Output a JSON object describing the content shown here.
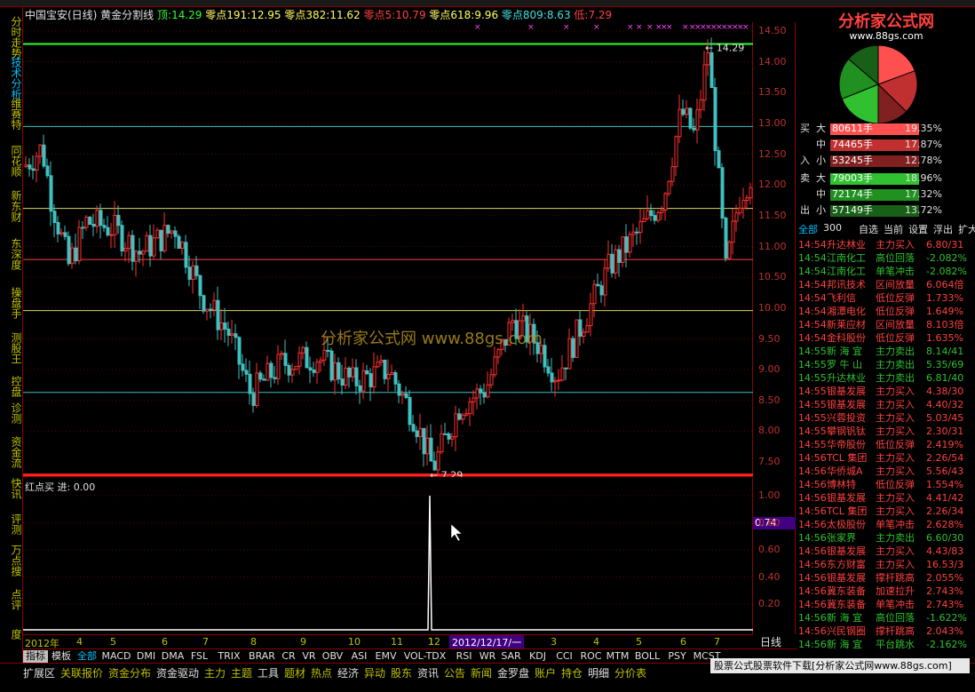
{
  "window": {
    "title": "中国宝安(日线) 黄金分割线"
  },
  "indicator": {
    "top_label": "顶:",
    "top_value": "14.29",
    "l191_label": "零点191:",
    "l191_value": "12.95",
    "l382_label": "零点382:",
    "l382_value": "11.62",
    "l5_label": "零点5:",
    "l5_value": "10.79",
    "l618_label": "零点618:",
    "l618_value": "9.96",
    "l809_label": "零点809:",
    "l809_value": "8.63",
    "low_label": "低:",
    "low_value": "7.29",
    "high_mark": "14.29",
    "low_mark": "7.29"
  },
  "colors": {
    "up": "#ff3030",
    "down": "#40c0c0",
    "gold_top": "#30ff30",
    "gold_low": "#ff2020",
    "cyan_line": "#40c0c0",
    "yellow_line": "#d8d860"
  },
  "left_nav": [
    "分时走势",
    "技术分析",
    "维赛特",
    "同花顺",
    "新东财",
    "东深度",
    "操盘手",
    "测股王",
    "控盘",
    "诊测",
    "资金流",
    "快讯",
    "评测",
    "万点搜",
    "点评",
    "度"
  ],
  "main_yaxis": [
    "14.50",
    "14.00",
    "13.50",
    "13.00",
    "12.50",
    "12.00",
    "11.50",
    "11.00",
    "10.50",
    "10.00",
    "9.50",
    "9.00",
    "8.50",
    "8.00",
    "7.50"
  ],
  "sub": {
    "title": "红点买 进: 0.00",
    "yaxis": [
      "1.00",
      "0.80",
      "0.60",
      "0.40",
      "0.20"
    ],
    "current": "0.74"
  },
  "xaxis": {
    "labels": [
      "2012年",
      "4",
      "5",
      "6",
      "7",
      "8",
      "9",
      "10",
      "11",
      "12",
      "1",
      "2",
      "3",
      "4",
      "5",
      "6",
      "7"
    ],
    "cursor_date": "2012/12/17/一",
    "period": "日线"
  },
  "watermark": "分析家公式网 www.88gs.com",
  "logo": {
    "name": "分析家公式网",
    "url": "www.88gs.com"
  },
  "flow": {
    "buy_side": "买",
    "sell_side": "卖",
    "in_side": "入",
    "out_side": "出",
    "rows": [
      {
        "side": "买",
        "size": "大",
        "vol": "80611手",
        "pct": "19.35%",
        "color": "#ff5050"
      },
      {
        "side": "",
        "size": "中",
        "vol": "74465手",
        "pct": "17.87%",
        "color": "#c03030"
      },
      {
        "side": "入",
        "size": "小",
        "vol": "53245手",
        "pct": "12.78%",
        "color": "#802020"
      },
      {
        "side": "卖",
        "size": "大",
        "vol": "79003手",
        "pct": "18.96%",
        "color": "#30c030"
      },
      {
        "side": "",
        "size": "中",
        "vol": "72174手",
        "pct": "17.32%",
        "color": "#209020"
      },
      {
        "side": "出",
        "size": "小",
        "vol": "57149手",
        "pct": "13.72%",
        "color": "#186018"
      }
    ]
  },
  "right_tabs": [
    "全部",
    "300",
    "自选",
    "当前",
    "设置",
    "浮出",
    "扩大"
  ],
  "ticks": [
    {
      "t": "14:54",
      "name": "升达林业",
      "act": "主力买入",
      "v": "6.80/31",
      "up": true
    },
    {
      "t": "14:54",
      "name": "江南化工",
      "act": "高位回落",
      "v": "-2.082%",
      "up": false
    },
    {
      "t": "14:54",
      "name": "江南化工",
      "act": "单笔冲击",
      "v": "-2.082%",
      "up": false
    },
    {
      "t": "14:54",
      "name": "邦讯技术",
      "act": "区间放量",
      "v": "6.064倍",
      "up": true
    },
    {
      "t": "14:54",
      "name": "飞利信",
      "act": "低位反弹",
      "v": "1.733%",
      "up": true
    },
    {
      "t": "14:54",
      "name": "湘潭电化",
      "act": "低位反弹",
      "v": "1.649%",
      "up": true
    },
    {
      "t": "14:54",
      "name": "新莱应材",
      "act": "区间放量",
      "v": "8.103倍",
      "up": true
    },
    {
      "t": "14:54",
      "name": "金科股份",
      "act": "低位反弹",
      "v": "1.635%",
      "up": true
    },
    {
      "t": "14:55",
      "name": "新 海 宜",
      "act": "主力卖出",
      "v": "8.14/41",
      "up": false
    },
    {
      "t": "14:55",
      "name": "罗 牛 山",
      "act": "主力卖出",
      "v": "5.35/69",
      "up": false
    },
    {
      "t": "14:55",
      "name": "升达林业",
      "act": "主力卖出",
      "v": "6.81/40",
      "up": false
    },
    {
      "t": "14:55",
      "name": "银基发展",
      "act": "主力买入",
      "v": "4.38/30",
      "up": true
    },
    {
      "t": "14:55",
      "name": "银基发展",
      "act": "主力买入",
      "v": "4.40/32",
      "up": true
    },
    {
      "t": "14:55",
      "name": "兴蓉投资",
      "act": "主力买入",
      "v": "5.03/45",
      "up": true
    },
    {
      "t": "14:55",
      "name": "攀钢钒钛",
      "act": "主力买入",
      "v": "2.30/31",
      "up": true
    },
    {
      "t": "14:55",
      "name": "华帝股份",
      "act": "低位反弹",
      "v": "2.419%",
      "up": true
    },
    {
      "t": "14:56",
      "name": "TCL 集团",
      "act": "主力买入",
      "v": "2.26/54",
      "up": true
    },
    {
      "t": "14:56",
      "name": "华侨城A",
      "act": "主力买入",
      "v": "5.56/43",
      "up": true
    },
    {
      "t": "14:56",
      "name": "博林特",
      "act": "低位反弹",
      "v": "1.554%",
      "up": true
    },
    {
      "t": "14:56",
      "name": "银基发展",
      "act": "主力买入",
      "v": "4.41/42",
      "up": true
    },
    {
      "t": "14:56",
      "name": "TCL 集团",
      "act": "主力买入",
      "v": "2.26/34",
      "up": true
    },
    {
      "t": "14:56",
      "name": "太极股份",
      "act": "单笔冲击",
      "v": "2.628%",
      "up": true
    },
    {
      "t": "14:56",
      "name": "张家界",
      "act": "主力卖出",
      "v": "6.60/30",
      "up": false
    },
    {
      "t": "14:56",
      "name": "银基发展",
      "act": "主力买入",
      "v": "4.43/83",
      "up": true
    },
    {
      "t": "14:56",
      "name": "东方财富",
      "act": "主力买入",
      "v": "16.53/3",
      "up": true
    },
    {
      "t": "14:56",
      "name": "银基发展",
      "act": "撑杆跳高",
      "v": "2.055%",
      "up": true
    },
    {
      "t": "14:56",
      "name": "冀东装备",
      "act": "加速拉升",
      "v": "2.743%",
      "up": true
    },
    {
      "t": "14:56",
      "name": "冀东装备",
      "act": "单笔冲击",
      "v": "2.743%",
      "up": true
    },
    {
      "t": "14:56",
      "name": "新 海 宜",
      "act": "高位回落",
      "v": "-1.622%",
      "up": false
    },
    {
      "t": "14:56",
      "name": "兴民钢圈",
      "act": "撑杆跳高",
      "v": "2.043%",
      "up": true
    },
    {
      "t": "14:56",
      "name": "新 海 宜",
      "act": "平台跳水",
      "v": "-2.162%",
      "up": false
    }
  ],
  "indicator_tabs": [
    "指标",
    "模板",
    "全部",
    "MACD",
    "DMI",
    "DMA",
    "FSL",
    "TRIX",
    "BRAR",
    "CR",
    "VR",
    "OBV",
    "ASI",
    "EMV",
    "VOL-TDX",
    "RSI",
    "WR",
    "SAR",
    "KDJ",
    "CCI",
    "ROC",
    "MTM",
    "BOLL",
    "PSY",
    "MCST"
  ],
  "bottom_menu": [
    "扩展区",
    "关联报价",
    "资金分布",
    "资金驱动",
    "主力",
    "主题",
    "工具",
    "题材",
    "热点",
    "经济",
    "异动",
    "股东",
    "资讯",
    "公告",
    "新闻",
    "金罗盘",
    "账户",
    "持仓",
    "明细",
    "分价表"
  ],
  "footer_ad": "股票公式股票软件下载[分析家公式网www.88gs.com]"
}
